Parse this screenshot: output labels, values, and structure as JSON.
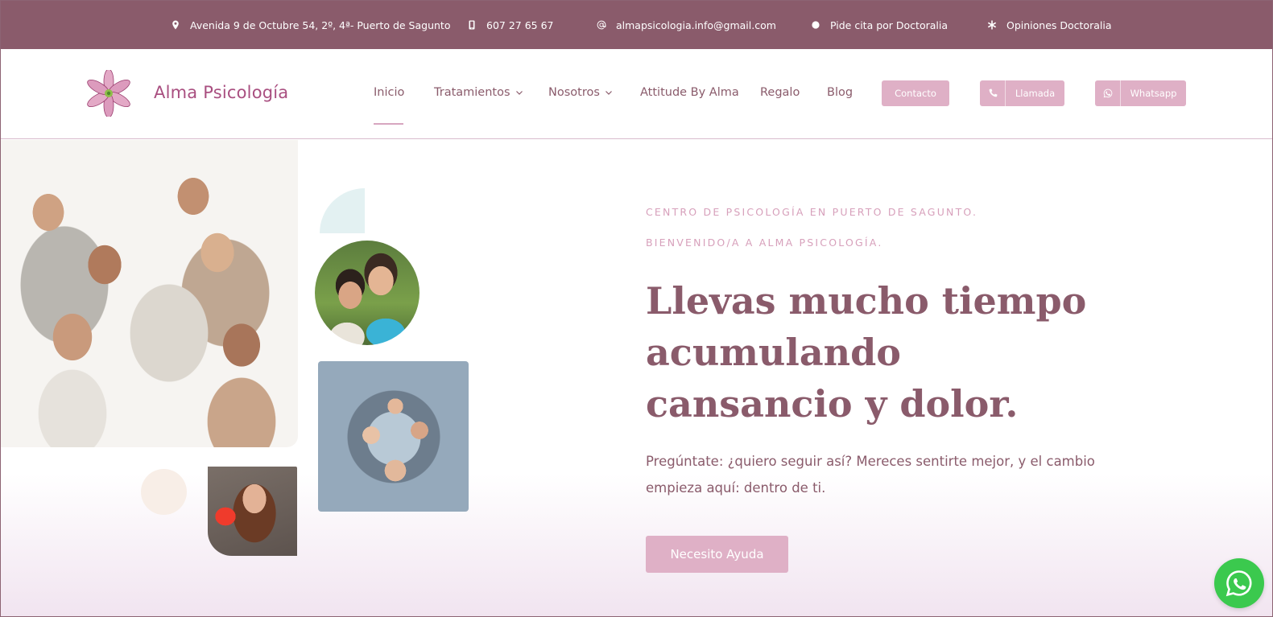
{
  "topbar": {
    "address": "Avenida 9 de Octubre 54, 2º, 4ª- Puerto de Sagunto",
    "phone": "607 27 65 67",
    "email": "almapsicologia.info@gmail.com",
    "doctoralia_booking": "Pide cita por Doctoralia",
    "doctoralia_reviews": "Opiniones Doctoralia"
  },
  "header": {
    "brand": "Alma Psicología",
    "nav": {
      "inicio": "Inicio",
      "tratamientos": "Tratamientos",
      "nosotros": "Nosotros",
      "attitude": "Attitude By Alma",
      "regalo": "Regalo",
      "blog": "Blog"
    },
    "buttons": {
      "contacto": "Contacto",
      "llamada": "Llamada",
      "whatsapp": "Whatsapp"
    }
  },
  "hero": {
    "eyebrow_1": "CENTRO DE PSICOLOGÍA EN PUERTO DE SAGUNTO.",
    "eyebrow_2": "BIENVENIDO/A A ALMA PSICOLOGÍA.",
    "headline": "Llevas mucho tiempo acumulando cansancio y dolor.",
    "subtext": "Pregúntate: ¿quiero seguir así? Mereces sentirte mejor, y el cambio empieza aquí: dentro de ti.",
    "cta": "Necesito Ayuda"
  },
  "colors": {
    "topbar_bg": "#8a5b6b",
    "accent_pink": "#dfb0c6",
    "brand_text": "#a94f80",
    "whatsapp_green": "#3bc94e"
  },
  "icons": {
    "address": "map-pin-icon",
    "phone": "mobile-phone-icon",
    "email": "at-sign-icon",
    "booking": "dot-icon",
    "reviews": "asterisk-icon",
    "call_button": "phone-icon",
    "whatsapp_button": "whatsapp-icon",
    "nav_dropdown": "chevron-down-icon"
  }
}
